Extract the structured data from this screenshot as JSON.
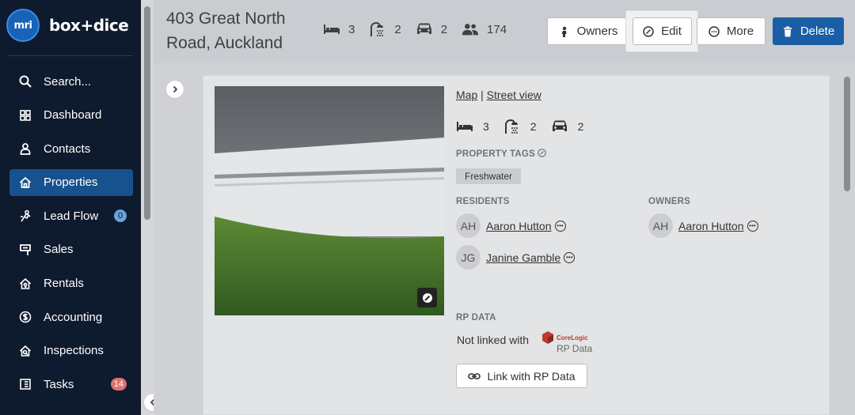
{
  "brand": {
    "logo_text": "mri",
    "name": "box+dice"
  },
  "sidebar": {
    "items": [
      {
        "label": "Search...",
        "icon": "search-icon"
      },
      {
        "label": "Dashboard",
        "icon": "dashboard-icon"
      },
      {
        "label": "Contacts",
        "icon": "person-icon"
      },
      {
        "label": "Properties",
        "icon": "home-icon",
        "active": true
      },
      {
        "label": "Lead Flow",
        "icon": "lead-flow-icon",
        "badge": "0"
      },
      {
        "label": "Sales",
        "icon": "sales-icon"
      },
      {
        "label": "Rentals",
        "icon": "rentals-icon"
      },
      {
        "label": "Accounting",
        "icon": "dollar-icon"
      },
      {
        "label": "Inspections",
        "icon": "inspections-icon"
      },
      {
        "label": "Tasks",
        "icon": "tasks-icon",
        "badge": "14"
      }
    ]
  },
  "header": {
    "title": "403 Great North Road, Auckland",
    "stats": {
      "bedrooms": "3",
      "bathrooms": "2",
      "garages": "2",
      "people": "174"
    },
    "buttons": {
      "owners": "Owners",
      "edit": "Edit",
      "more": "More",
      "delete": "Delete"
    }
  },
  "details": {
    "map_link": "Map",
    "separator": "|",
    "street_view_link": "Street view",
    "stats": {
      "bedrooms": "3",
      "bathrooms": "2",
      "garages": "2"
    },
    "property_tags_label": "PROPERTY TAGS",
    "tags": [
      "Freshwater"
    ],
    "residents_label": "RESIDENTS",
    "residents": [
      {
        "initials": "AH",
        "name": "Aaron Hutton"
      },
      {
        "initials": "JG",
        "name": "Janine Gamble"
      }
    ],
    "owners_label": "OWNERS",
    "owners": [
      {
        "initials": "AH",
        "name": "Aaron Hutton"
      }
    ],
    "rp_data_label": "RP DATA",
    "rp_not_linked": "Not linked with",
    "rp_logo_top": "CoreLogic",
    "rp_logo_bottom": "RP Data",
    "rp_link_button": "Link with RP Data"
  },
  "colors": {
    "sidebar_bg": "#0e1a2e",
    "active": "#17528e",
    "delete": "#1a5fa6"
  }
}
